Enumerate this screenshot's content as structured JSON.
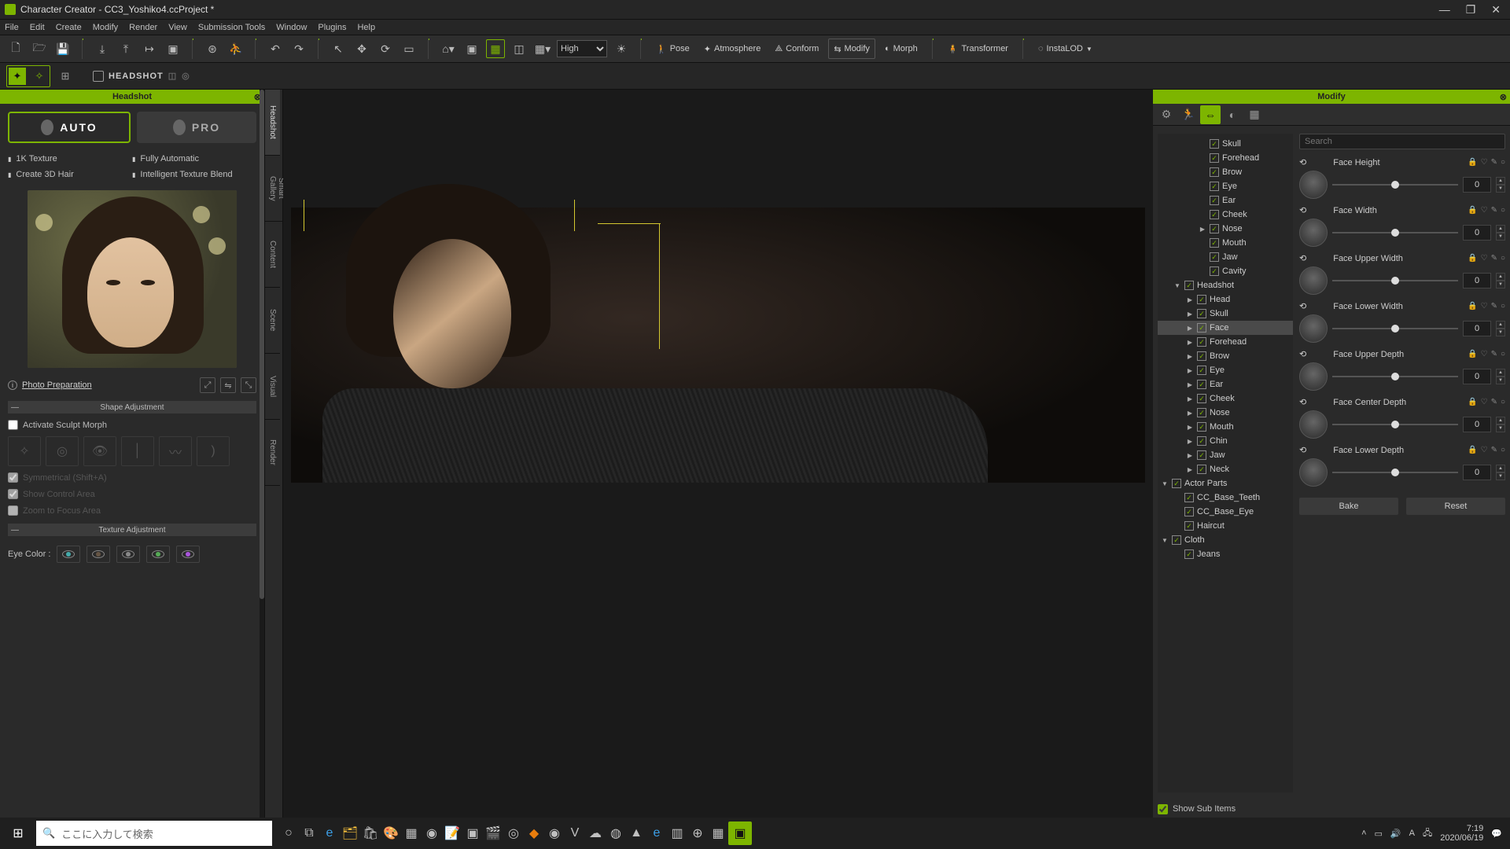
{
  "window": {
    "title": "Character Creator - CC3_Yoshiko4.ccProject *"
  },
  "menus": [
    "File",
    "Edit",
    "Create",
    "Modify",
    "Render",
    "View",
    "Submission Tools",
    "Window",
    "Plugins",
    "Help"
  ],
  "toolbar": {
    "quality": "High",
    "pose": "Pose",
    "atmosphere": "Atmosphere",
    "conform": "Conform",
    "modify": "Modify",
    "morph": "Morph",
    "transformer": "Transformer",
    "instalod": "InstaLOD"
  },
  "headshot_bar": "HEADSHOT",
  "left_panel": {
    "title": "Headshot",
    "mode_auto": "AUTO",
    "mode_pro": "PRO",
    "features_l": [
      "1K Texture",
      "Create 3D Hair"
    ],
    "features_r": [
      "Fully Automatic",
      "Intelligent Texture Blend"
    ],
    "photo_prep": "Photo Preparation",
    "shape_hdr": "Shape Adjustment",
    "activate_morph": "Activate Sculpt Morph",
    "sym": "Symmetrical (Shift+A)",
    "ctrl_area": "Show Control Area",
    "zoom_focus": "Zoom to Focus Area",
    "texture_hdr": "Texture Adjustment",
    "eye_color": "Eye Color :"
  },
  "side_tabs": [
    "Headshot",
    "Smart Gallery",
    "Content",
    "Scene",
    "Visual",
    "Render"
  ],
  "right_panel": {
    "title": "Modify",
    "search_ph": "Search",
    "tree_top": [
      "Skull",
      "Forehead",
      "Brow",
      "Eye",
      "Ear",
      "Cheek",
      "Nose",
      "Mouth",
      "Jaw",
      "Cavity"
    ],
    "tree_headshot": "Headshot",
    "tree_sub": [
      "Head",
      "Skull",
      "Face",
      "Forehead",
      "Brow",
      "Eye",
      "Ear",
      "Cheek",
      "Nose",
      "Mouth",
      "Chin",
      "Jaw",
      "Neck"
    ],
    "tree_actor": "Actor Parts",
    "tree_actor_sub": [
      "CC_Base_Teeth",
      "CC_Base_Eye",
      "Haircut"
    ],
    "tree_cloth": "Cloth",
    "tree_cloth_sub": [
      "Jeans"
    ],
    "sliders": [
      {
        "name": "Face Height",
        "val": "0"
      },
      {
        "name": "Face Width",
        "val": "0"
      },
      {
        "name": "Face Upper Width",
        "val": "0"
      },
      {
        "name": "Face Lower Width",
        "val": "0"
      },
      {
        "name": "Face Upper Depth",
        "val": "0"
      },
      {
        "name": "Face Center Depth",
        "val": "0"
      },
      {
        "name": "Face Lower Depth",
        "val": "0"
      }
    ],
    "bake": "Bake",
    "reset": "Reset",
    "show_sub": "Show Sub Items"
  },
  "taskbar": {
    "search_ph": "ここに入力して検索",
    "time": "7:19",
    "date": "2020/06/19"
  }
}
